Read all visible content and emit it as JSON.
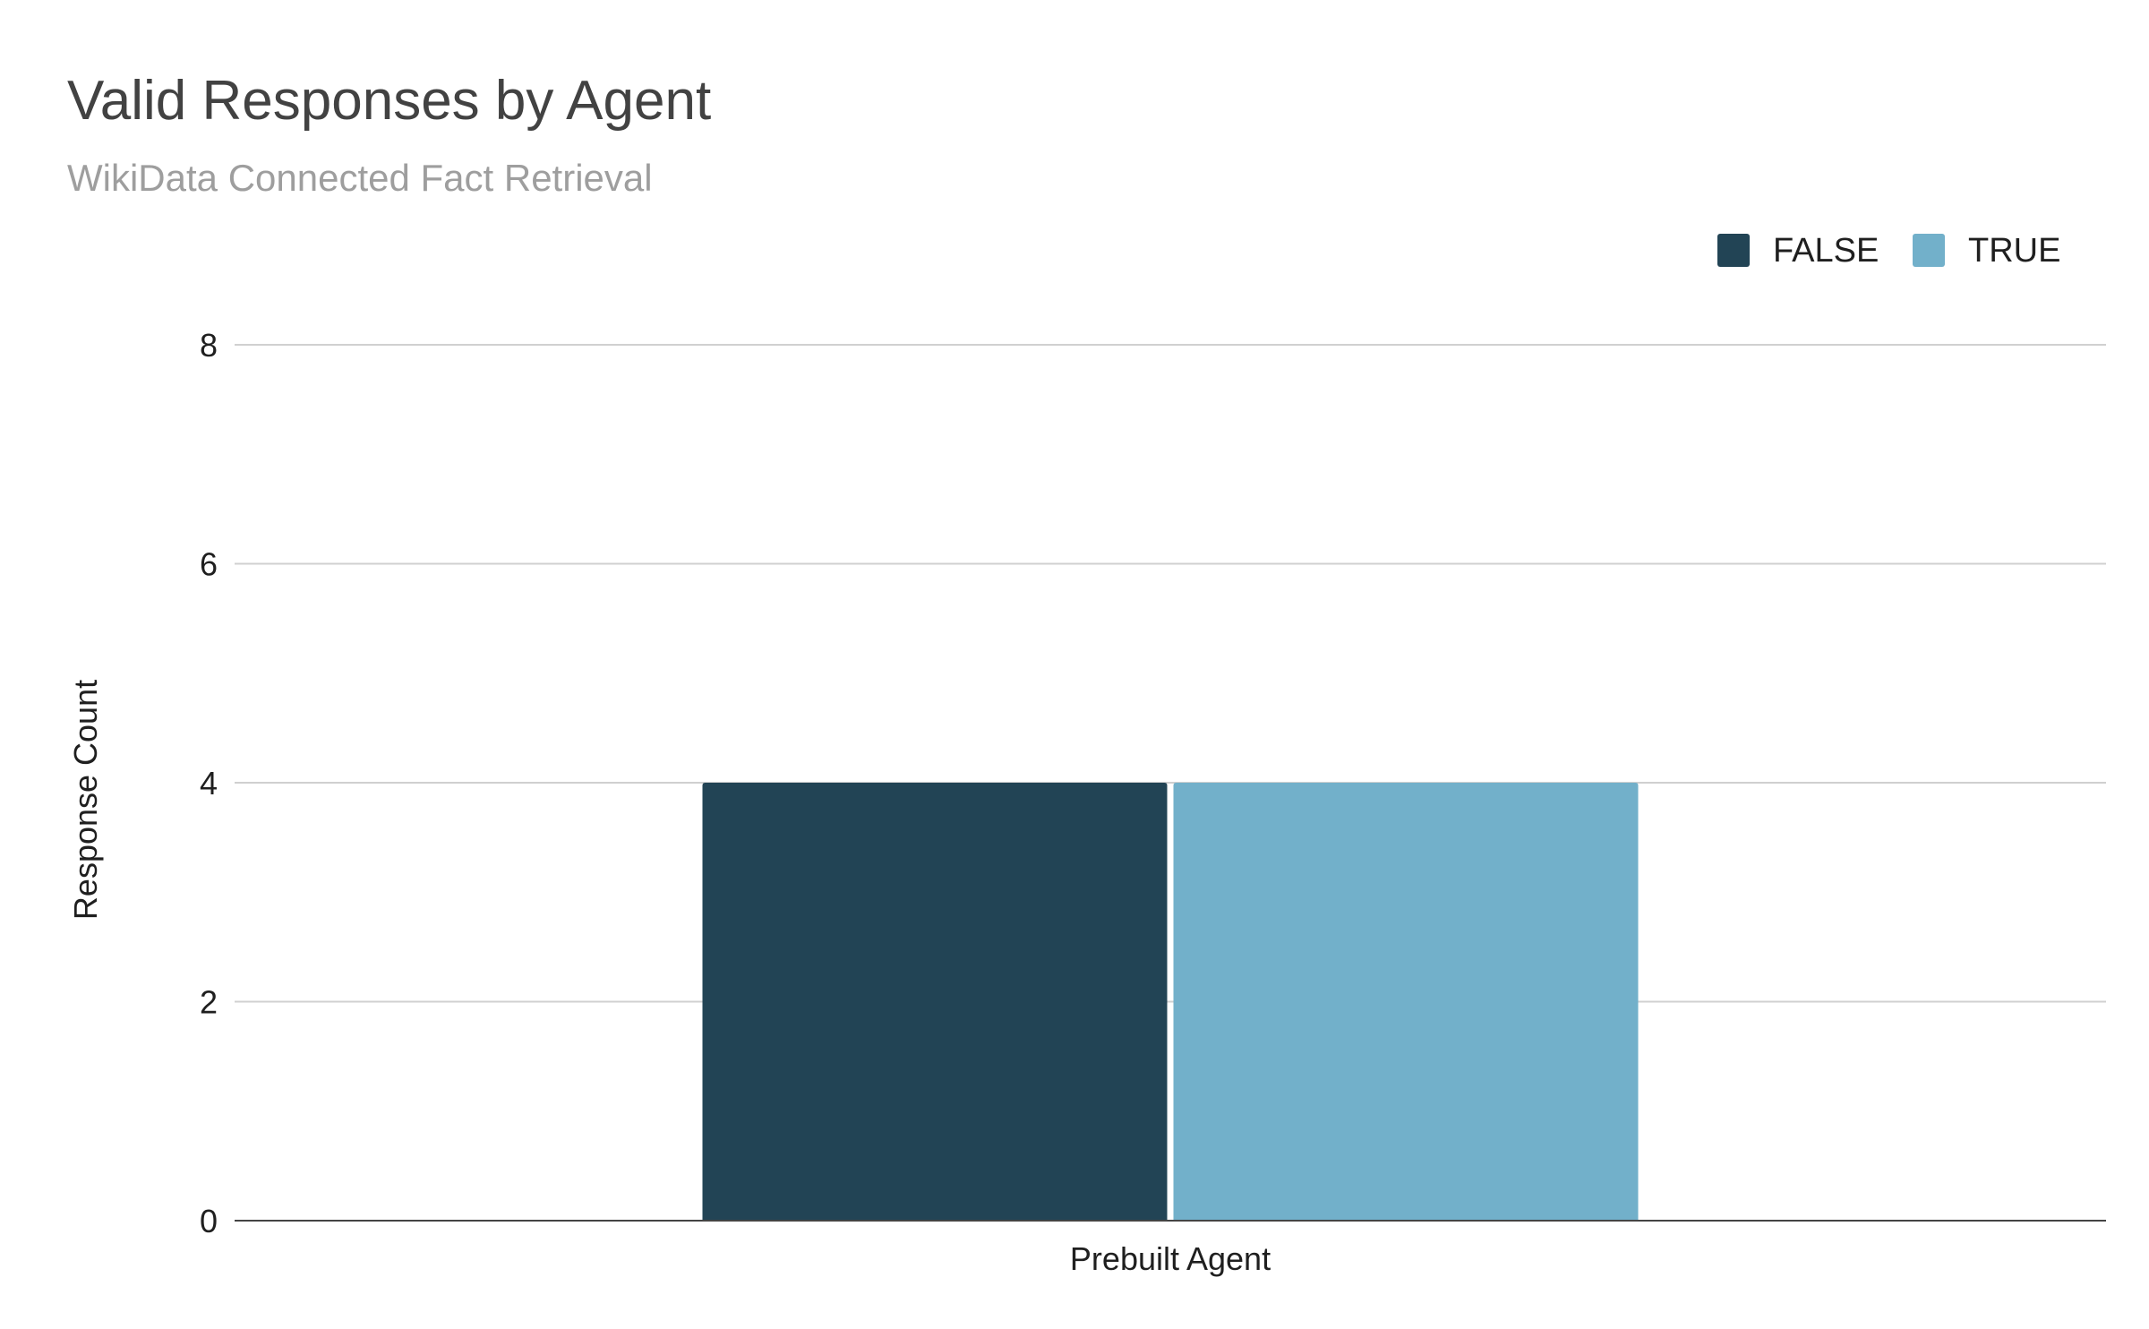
{
  "chart_data": {
    "type": "bar",
    "title": "Valid Responses by Agent",
    "subtitle": "WikiData Connected Fact Retrieval",
    "xlabel": "",
    "ylabel": "Response Count",
    "categories": [
      "Prebuilt Agent"
    ],
    "series": [
      {
        "name": "FALSE",
        "values": [
          4
        ],
        "color": "#224455"
      },
      {
        "name": "TRUE",
        "values": [
          4
        ],
        "color": "#72b0ca"
      }
    ],
    "ylim": [
      0,
      8
    ],
    "yticks": [
      0,
      2,
      4,
      6,
      8
    ],
    "grid": true,
    "legend_position": "top-right"
  }
}
